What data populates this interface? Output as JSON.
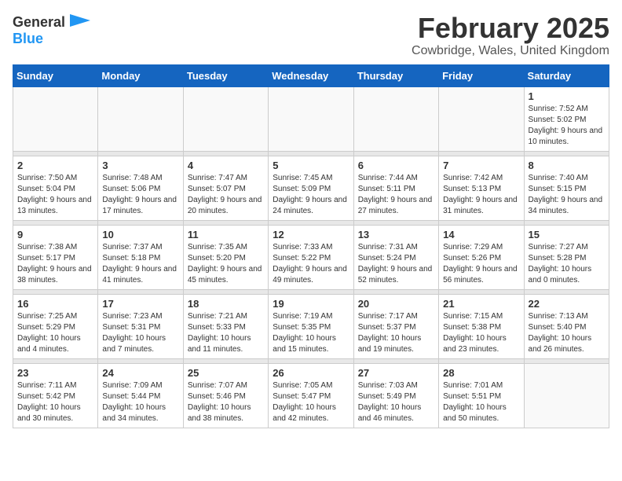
{
  "logo": {
    "general": "General",
    "blue": "Blue"
  },
  "title": "February 2025",
  "location": "Cowbridge, Wales, United Kingdom",
  "weekdays": [
    "Sunday",
    "Monday",
    "Tuesday",
    "Wednesday",
    "Thursday",
    "Friday",
    "Saturday"
  ],
  "weeks": [
    [
      {
        "day": "",
        "info": ""
      },
      {
        "day": "",
        "info": ""
      },
      {
        "day": "",
        "info": ""
      },
      {
        "day": "",
        "info": ""
      },
      {
        "day": "",
        "info": ""
      },
      {
        "day": "",
        "info": ""
      },
      {
        "day": "1",
        "info": "Sunrise: 7:52 AM\nSunset: 5:02 PM\nDaylight: 9 hours and 10 minutes."
      }
    ],
    [
      {
        "day": "2",
        "info": "Sunrise: 7:50 AM\nSunset: 5:04 PM\nDaylight: 9 hours and 13 minutes."
      },
      {
        "day": "3",
        "info": "Sunrise: 7:48 AM\nSunset: 5:06 PM\nDaylight: 9 hours and 17 minutes."
      },
      {
        "day": "4",
        "info": "Sunrise: 7:47 AM\nSunset: 5:07 PM\nDaylight: 9 hours and 20 minutes."
      },
      {
        "day": "5",
        "info": "Sunrise: 7:45 AM\nSunset: 5:09 PM\nDaylight: 9 hours and 24 minutes."
      },
      {
        "day": "6",
        "info": "Sunrise: 7:44 AM\nSunset: 5:11 PM\nDaylight: 9 hours and 27 minutes."
      },
      {
        "day": "7",
        "info": "Sunrise: 7:42 AM\nSunset: 5:13 PM\nDaylight: 9 hours and 31 minutes."
      },
      {
        "day": "8",
        "info": "Sunrise: 7:40 AM\nSunset: 5:15 PM\nDaylight: 9 hours and 34 minutes."
      }
    ],
    [
      {
        "day": "9",
        "info": "Sunrise: 7:38 AM\nSunset: 5:17 PM\nDaylight: 9 hours and 38 minutes."
      },
      {
        "day": "10",
        "info": "Sunrise: 7:37 AM\nSunset: 5:18 PM\nDaylight: 9 hours and 41 minutes."
      },
      {
        "day": "11",
        "info": "Sunrise: 7:35 AM\nSunset: 5:20 PM\nDaylight: 9 hours and 45 minutes."
      },
      {
        "day": "12",
        "info": "Sunrise: 7:33 AM\nSunset: 5:22 PM\nDaylight: 9 hours and 49 minutes."
      },
      {
        "day": "13",
        "info": "Sunrise: 7:31 AM\nSunset: 5:24 PM\nDaylight: 9 hours and 52 minutes."
      },
      {
        "day": "14",
        "info": "Sunrise: 7:29 AM\nSunset: 5:26 PM\nDaylight: 9 hours and 56 minutes."
      },
      {
        "day": "15",
        "info": "Sunrise: 7:27 AM\nSunset: 5:28 PM\nDaylight: 10 hours and 0 minutes."
      }
    ],
    [
      {
        "day": "16",
        "info": "Sunrise: 7:25 AM\nSunset: 5:29 PM\nDaylight: 10 hours and 4 minutes."
      },
      {
        "day": "17",
        "info": "Sunrise: 7:23 AM\nSunset: 5:31 PM\nDaylight: 10 hours and 7 minutes."
      },
      {
        "day": "18",
        "info": "Sunrise: 7:21 AM\nSunset: 5:33 PM\nDaylight: 10 hours and 11 minutes."
      },
      {
        "day": "19",
        "info": "Sunrise: 7:19 AM\nSunset: 5:35 PM\nDaylight: 10 hours and 15 minutes."
      },
      {
        "day": "20",
        "info": "Sunrise: 7:17 AM\nSunset: 5:37 PM\nDaylight: 10 hours and 19 minutes."
      },
      {
        "day": "21",
        "info": "Sunrise: 7:15 AM\nSunset: 5:38 PM\nDaylight: 10 hours and 23 minutes."
      },
      {
        "day": "22",
        "info": "Sunrise: 7:13 AM\nSunset: 5:40 PM\nDaylight: 10 hours and 26 minutes."
      }
    ],
    [
      {
        "day": "23",
        "info": "Sunrise: 7:11 AM\nSunset: 5:42 PM\nDaylight: 10 hours and 30 minutes."
      },
      {
        "day": "24",
        "info": "Sunrise: 7:09 AM\nSunset: 5:44 PM\nDaylight: 10 hours and 34 minutes."
      },
      {
        "day": "25",
        "info": "Sunrise: 7:07 AM\nSunset: 5:46 PM\nDaylight: 10 hours and 38 minutes."
      },
      {
        "day": "26",
        "info": "Sunrise: 7:05 AM\nSunset: 5:47 PM\nDaylight: 10 hours and 42 minutes."
      },
      {
        "day": "27",
        "info": "Sunrise: 7:03 AM\nSunset: 5:49 PM\nDaylight: 10 hours and 46 minutes."
      },
      {
        "day": "28",
        "info": "Sunrise: 7:01 AM\nSunset: 5:51 PM\nDaylight: 10 hours and 50 minutes."
      },
      {
        "day": "",
        "info": ""
      }
    ]
  ]
}
